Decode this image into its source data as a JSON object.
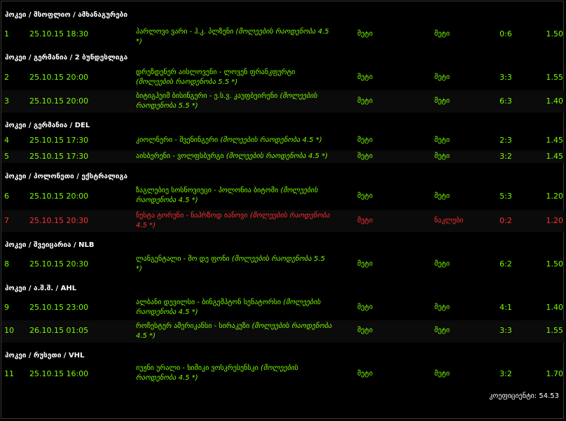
{
  "sections": [
    {
      "title": "ჰოკეი / მსოფლიო / ამხანაგურები",
      "rows": [
        {
          "num": "1",
          "date": "25.10.15 18:30",
          "teams": "პარლოვი ვარი - ჰ.კ. პლზენი",
          "extra": "(მოლეების რაოდენობა 4.5 *)",
          "prediction": "მეტი",
          "result": "მეტი",
          "score": "0:6",
          "odd": "1.50",
          "status": "win"
        }
      ]
    },
    {
      "title": "ჰოკეი / გერმანია / 2 ბუნდესლიგა",
      "rows": [
        {
          "num": "2",
          "date": "25.10.15 20:00",
          "teams": "დრეზდენერ აისლოვენი - ლოვენ ფრანკფურტი",
          "extra": "(მოლეების რაოდენობა 5.5 *)",
          "prediction": "მეტი",
          "result": "მეტი",
          "score": "3:3",
          "odd": "1.55",
          "status": "win"
        },
        {
          "num": "3",
          "date": "25.10.15 20:00",
          "teams": "ბიტიგჰეიმ ბისინგერი - ე.ს.ვ. კაუფბეირენი",
          "extra": "(მოლეების რაოდენობა 5.5 *)",
          "prediction": "მეტი",
          "result": "მეტი",
          "score": "6:3",
          "odd": "1.40",
          "status": "win"
        }
      ]
    },
    {
      "title": "ჰოკეი / გერმანია / DEL",
      "rows": [
        {
          "num": "4",
          "date": "25.10.15 17:30",
          "teams": "კიოლნერი - შვენინგერი",
          "extra": "(მოლეების რაოდენობა 4.5 *)",
          "prediction": "მეტი",
          "result": "მეტი",
          "score": "2:3",
          "odd": "1.45",
          "status": "win"
        },
        {
          "num": "5",
          "date": "25.10.15 17:30",
          "teams": "აისბერენი - ვოლფსბურგი",
          "extra": "(მოლეების რაოდენობა 4.5 *)",
          "prediction": "მეტი",
          "result": "მეტი",
          "score": "3:2",
          "odd": "1.45",
          "status": "win"
        }
      ]
    },
    {
      "title": "ჰოკეი / პოლონეთი / ექსტრალიგა",
      "rows": [
        {
          "num": "6",
          "date": "25.10.15 20:00",
          "teams": "ზაგლებიე სოსნოვიეცი - პოლონია ბიტომი",
          "extra": "(მოლეების რაოდენობა 4.5 *)",
          "prediction": "მეტი",
          "result": "მეტი",
          "score": "5:3",
          "odd": "1.20",
          "status": "win"
        },
        {
          "num": "7",
          "date": "25.10.15 20:30",
          "teams": "ნესტა ტორუნი - ნაპრზოდ იანოვი",
          "extra": "(მოლეების რაოდენობა 4.5 *)",
          "prediction": "მეტი",
          "result": "ნაკლები",
          "score": "0:2",
          "odd": "1.20",
          "status": "lost"
        }
      ]
    },
    {
      "title": "ჰოკეი / შვეიცარია / NLB",
      "rows": [
        {
          "num": "8",
          "date": "25.10.15 20:30",
          "teams": "ლანგენტალი - შო დე ფონი",
          "extra": "(მოლეების რაოდენობა 5.5 *)",
          "prediction": "მეტი",
          "result": "მეტი",
          "score": "6:2",
          "odd": "1.50",
          "status": "win"
        }
      ]
    },
    {
      "title": "ჰოკეი / ა.შ.შ. / AHL",
      "rows": [
        {
          "num": "9",
          "date": "25.10.15 23:00",
          "teams": "ალბანი დევილსი - ბინგემპტონ სენატორსი",
          "extra": "(მოლეების რაოდენობა 4.5 *)",
          "prediction": "მეტი",
          "result": "მეტი",
          "score": "4:1",
          "odd": "1.40",
          "status": "win"
        },
        {
          "num": "10",
          "date": "26.10.15 01:05",
          "teams": "როჩესტერ ამერიკანსი - სირაკუზი",
          "extra": "(მოლეების რაოდენობა 4.5 *)",
          "prediction": "მეტი",
          "result": "მეტი",
          "score": "3:3",
          "odd": "1.55",
          "status": "win"
        }
      ]
    },
    {
      "title": "ჰოკეი / რუსეთი / VHL",
      "rows": [
        {
          "num": "11",
          "date": "25.10.15 16:00",
          "teams": "იუჟნი ურალი - ხიმიკი ვოსკრესენსკი",
          "extra": "(მოლეების რაოდენობა 4.5 *)",
          "prediction": "მეტი",
          "result": "მეტი",
          "score": "3:2",
          "odd": "1.70",
          "status": "win"
        }
      ]
    }
  ],
  "total": {
    "label": "კოეფიციენტი:",
    "value": "54.53"
  },
  "colors": {
    "win": "#7cfc00",
    "lost": "#ff3030",
    "header": "#ffffff",
    "background": "#000000"
  }
}
